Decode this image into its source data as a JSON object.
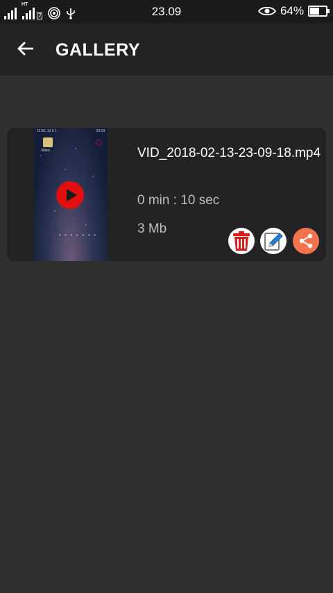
{
  "status_bar": {
    "network_label": "HT",
    "sim_label": "2",
    "time": "23.09",
    "battery_percent": "64%",
    "battery_level": 0.64
  },
  "app_bar": {
    "title": "GALLERY",
    "back_icon": "arrow-left-icon"
  },
  "videos": [
    {
      "file_name": "VID_2018-02-13-23-09-18.mp4",
      "duration": "0 min : 10 sec",
      "size": "3 Mb",
      "thumbnail": {
        "status_left": "11:56, 13 0 1",
        "status_time": "23.09",
        "app_label": "Video",
        "dots": "• • • • • • •"
      },
      "actions": [
        {
          "name": "delete",
          "icon": "trash-icon"
        },
        {
          "name": "edit",
          "icon": "pencil-icon"
        },
        {
          "name": "share",
          "icon": "share-icon"
        }
      ]
    }
  ],
  "colors": {
    "background": "#303030",
    "app_bar": "#232323",
    "card": "#232323",
    "play_button": "#e01010",
    "delete_red": "#d81b1b",
    "edit_blue": "#2a7fd4",
    "share_orange": "#f2734d"
  }
}
